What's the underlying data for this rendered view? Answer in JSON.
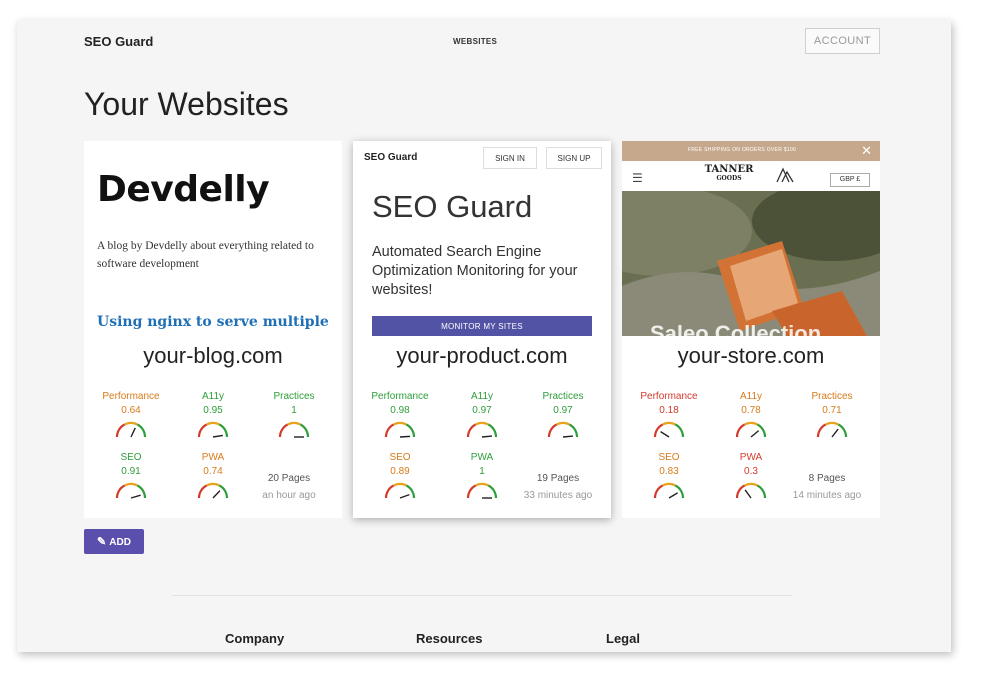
{
  "header": {
    "brand": "SEO Guard",
    "nav_websites": "WEBSITES",
    "account_label": "ACCOUNT"
  },
  "page_title": "Your Websites",
  "colors": {
    "accent": "#5a4fad",
    "bad": "#d33a2c",
    "medium": "#d87a1a",
    "good": "#2e9e3a"
  },
  "cards": [
    {
      "preview": {
        "title": "Devdelly",
        "description": "A blog by Devdelly about everything related to software development",
        "post_title": "Using nginx to serve multiple"
      },
      "domain": "your-blog.com",
      "metrics": [
        {
          "label": "Performance",
          "value": "0.64",
          "score": 0.64
        },
        {
          "label": "A11y",
          "value": "0.95",
          "score": 0.95
        },
        {
          "label": "Practices",
          "value": "1",
          "score": 1
        },
        {
          "label": "SEO",
          "value": "0.91",
          "score": 0.91
        },
        {
          "label": "PWA",
          "value": "0.74",
          "score": 0.74
        }
      ],
      "pages": "20 Pages",
      "updated": "an hour ago"
    },
    {
      "preview": {
        "brand": "SEO Guard",
        "sign_in": "SIGN IN",
        "sign_up": "SIGN UP",
        "hero": "SEO Guard",
        "subtitle": "Automated Search Engine Optimization Monitoring for your websites!",
        "cta": "MONITOR MY SITES"
      },
      "domain": "your-product.com",
      "metrics": [
        {
          "label": "Performance",
          "value": "0.98",
          "score": 0.98
        },
        {
          "label": "A11y",
          "value": "0.97",
          "score": 0.97
        },
        {
          "label": "Practices",
          "value": "0.97",
          "score": 0.97
        },
        {
          "label": "SEO",
          "value": "0.89",
          "score": 0.89
        },
        {
          "label": "PWA",
          "value": "1",
          "score": 1
        }
      ],
      "pages": "19 Pages",
      "updated": "33 minutes ago"
    },
    {
      "preview": {
        "banner": "FREE SHIPPING ON ORDERS OVER $100",
        "logo_main": "TANNER",
        "logo_sub": "GOODS",
        "currency": "GBP £",
        "photo_caption": "Saleo Collection"
      },
      "domain": "your-store.com",
      "metrics": [
        {
          "label": "Performance",
          "value": "0.18",
          "score": 0.18
        },
        {
          "label": "A11y",
          "value": "0.78",
          "score": 0.78
        },
        {
          "label": "Practices",
          "value": "0.71",
          "score": 0.71
        },
        {
          "label": "SEO",
          "value": "0.83",
          "score": 0.83
        },
        {
          "label": "PWA",
          "value": "0.3",
          "score": 0.3
        }
      ],
      "pages": "8 Pages",
      "updated": "14 minutes ago"
    }
  ],
  "add_button": "ADD",
  "footer": {
    "columns": [
      "Company",
      "Resources",
      "Legal"
    ]
  }
}
